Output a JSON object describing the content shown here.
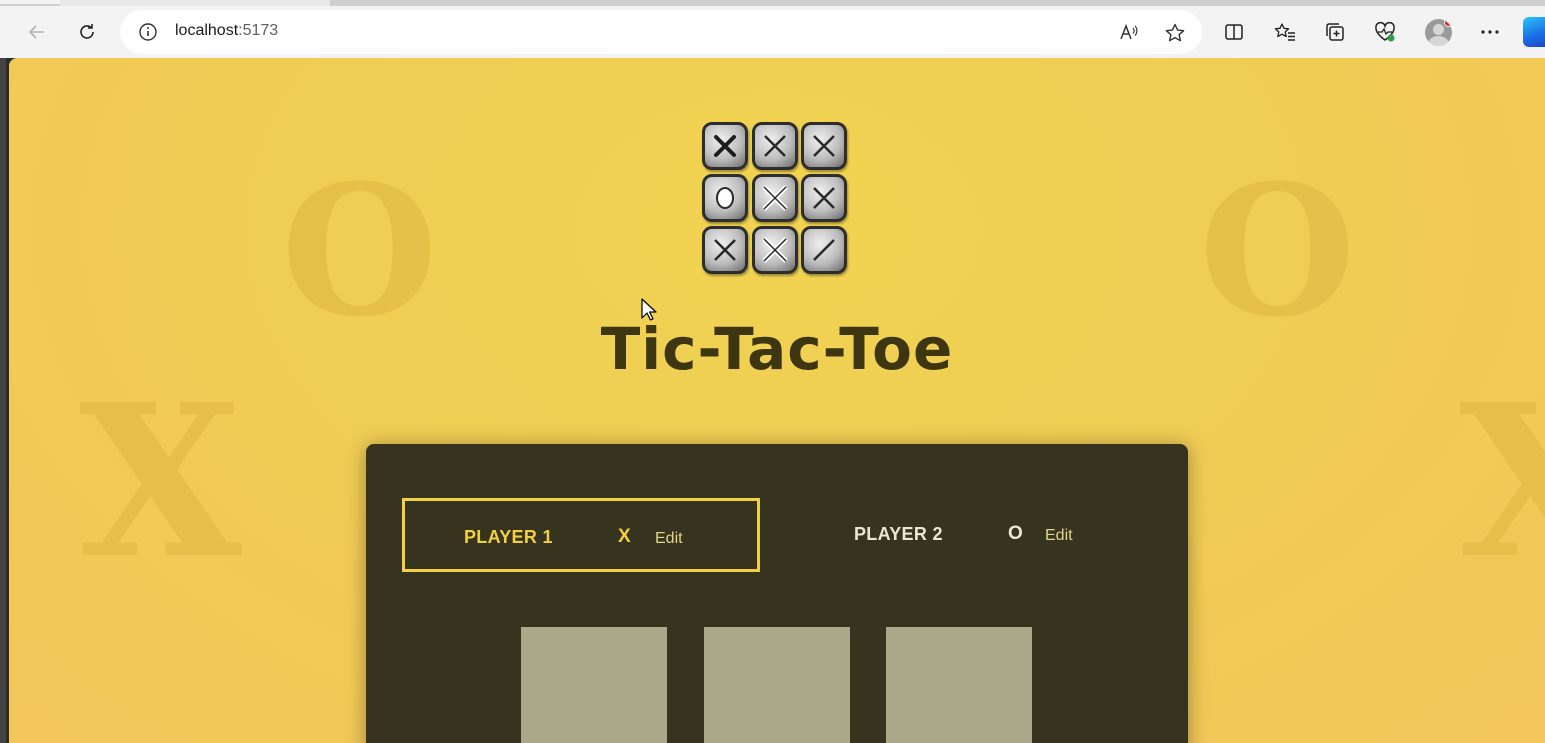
{
  "browser": {
    "url_host": "localhost",
    "url_port": ":5173"
  },
  "page": {
    "title": "Tic-Tac-Toe",
    "players": [
      {
        "name": "PLAYER 1",
        "symbol": "X",
        "edit_label": "Edit",
        "active": true
      },
      {
        "name": "PLAYER 2",
        "symbol": "O",
        "edit_label": "Edit",
        "active": false
      }
    ],
    "board": [
      null,
      null,
      null
    ]
  },
  "colors": {
    "page_background": "#f0cd54",
    "panel_background": "#36331f",
    "accent": "#f3d03f",
    "board_cell": "#aba78a",
    "title": "#3e3610"
  }
}
